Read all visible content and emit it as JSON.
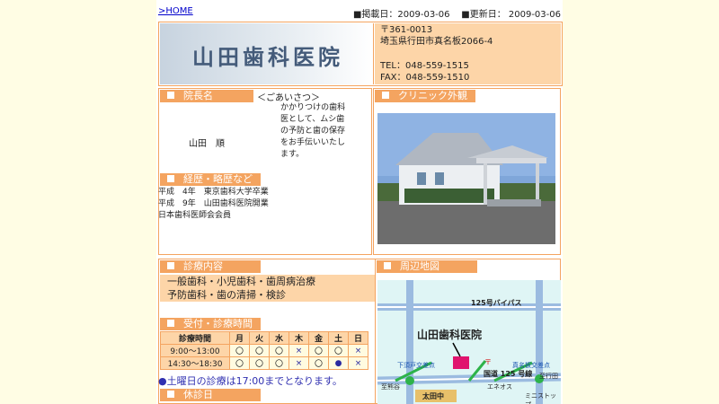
{
  "nav": {
    "home_link": ">HOME"
  },
  "dates": {
    "posted": "■掲載日：2009-03-06",
    "updated": "■更新日： 2009-03-06"
  },
  "clinic": {
    "name": "山田歯科医院"
  },
  "address": {
    "postal": "〒361-0013",
    "street": "埼玉県行田市真名板2066-4",
    "tel": "TEL：048-559-1515",
    "fax": "FAX：048-559-1510"
  },
  "director": {
    "section": "院長名",
    "greeting_title": "＜ごあいさつ＞",
    "name": "山田　順",
    "greeting_lines": [
      "かかりつけの歯科",
      "医として、ムシ歯",
      "の予防と歯の保存",
      "をお手伝いいたし",
      "ます。"
    ]
  },
  "career": {
    "section": "経歴・略歴など",
    "lines": [
      "平成　4年　東京歯科大学卒業",
      "平成　9年　山田歯科医院開業",
      "日本歯科医師会会員"
    ]
  },
  "exterior": {
    "section": "クリニック外観"
  },
  "services": {
    "section": "診療内容",
    "line1": "一般歯科・小児歯科・歯周病治療",
    "line2": "予防歯科・歯の清掃・検診"
  },
  "hours": {
    "section": "受付・診療時間",
    "header": [
      "診療時間",
      "月",
      "火",
      "水",
      "木",
      "金",
      "土",
      "日"
    ],
    "rows": [
      {
        "time": "9:00～13:00",
        "marks": [
          "〇",
          "〇",
          "〇",
          "×",
          "〇",
          "〇",
          "×"
        ]
      },
      {
        "time": "14:30～18:30",
        "marks": [
          "〇",
          "〇",
          "〇",
          "×",
          "〇",
          "●",
          "×"
        ]
      }
    ],
    "note": "●土曜日の診療は17:00までとなります。"
  },
  "holidays": {
    "section": "休診日"
  },
  "map": {
    "section": "周辺地図",
    "road_bypass": "125号バイパス",
    "clinic_label": "山田歯科医院",
    "shimosu": "下須戸交差点",
    "manaita": "真名板交差点",
    "kokudo": "国道 125 号線",
    "gyoda": "至行田",
    "kumagaya": "至熊谷",
    "eneos": "エネオス",
    "ota": "太田中",
    "minishop": "ミニストップ",
    "post_mark": "〒"
  },
  "colors": {
    "accent": "#f4a460",
    "accent_light": "#fdd5a8",
    "background": "#fffde4",
    "link": "#0000cc"
  }
}
